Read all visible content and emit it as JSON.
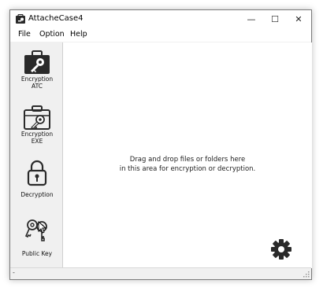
{
  "window": {
    "title": "AttacheCase4"
  },
  "titlebar_buttons": {
    "minimize": "—",
    "maximize": "☐",
    "close": "✕"
  },
  "menu": {
    "file": "File",
    "option": "Option",
    "help": "Help"
  },
  "sidebar": {
    "encrypt_atc": {
      "line1": "Encryption",
      "line2": "ATC"
    },
    "encrypt_exe": {
      "line1": "Encryption",
      "line2": "EXE"
    },
    "decryption": {
      "line1": "Decryption"
    },
    "public_key": {
      "line1": "Public Key"
    }
  },
  "drop_area": {
    "line1": "Drag and drop files or folders here",
    "line2": "in this area for encryption or decryption."
  },
  "statusbar": {
    "text": "-"
  },
  "colors": {
    "window_bg": "#f0f0f0",
    "content_bg": "#ffffff",
    "icon_dark": "#2a2a2a"
  }
}
